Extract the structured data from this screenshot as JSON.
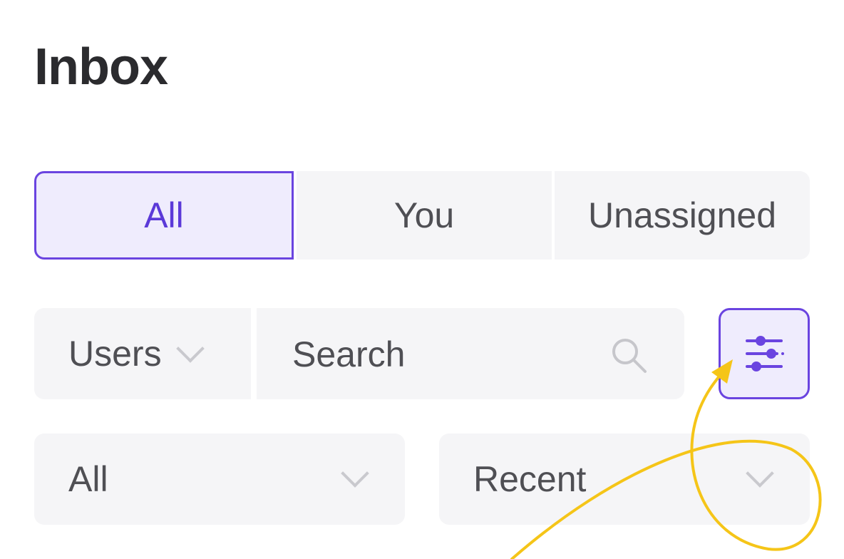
{
  "header": {
    "title": "Inbox"
  },
  "tabs": [
    {
      "label": "All",
      "active": true
    },
    {
      "label": "You",
      "active": false
    },
    {
      "label": "Unassigned",
      "active": false
    }
  ],
  "filters": {
    "users_select": {
      "selected": "Users",
      "icon": "chevron-down-icon"
    },
    "search": {
      "value": "",
      "placeholder": "Search",
      "icon": "search-icon"
    },
    "filter_button": {
      "icon": "sliders-icon"
    }
  },
  "dropdowns": {
    "status": {
      "selected": "All",
      "icon": "chevron-down-icon"
    },
    "sort": {
      "selected": "Recent",
      "icon": "chevron-down-icon"
    }
  },
  "colors": {
    "accent": "#6a44e0",
    "accent_bg": "#efecfd",
    "control_bg": "#f5f5f7",
    "text": "#4f4f54",
    "annotation": "#f5c518"
  }
}
